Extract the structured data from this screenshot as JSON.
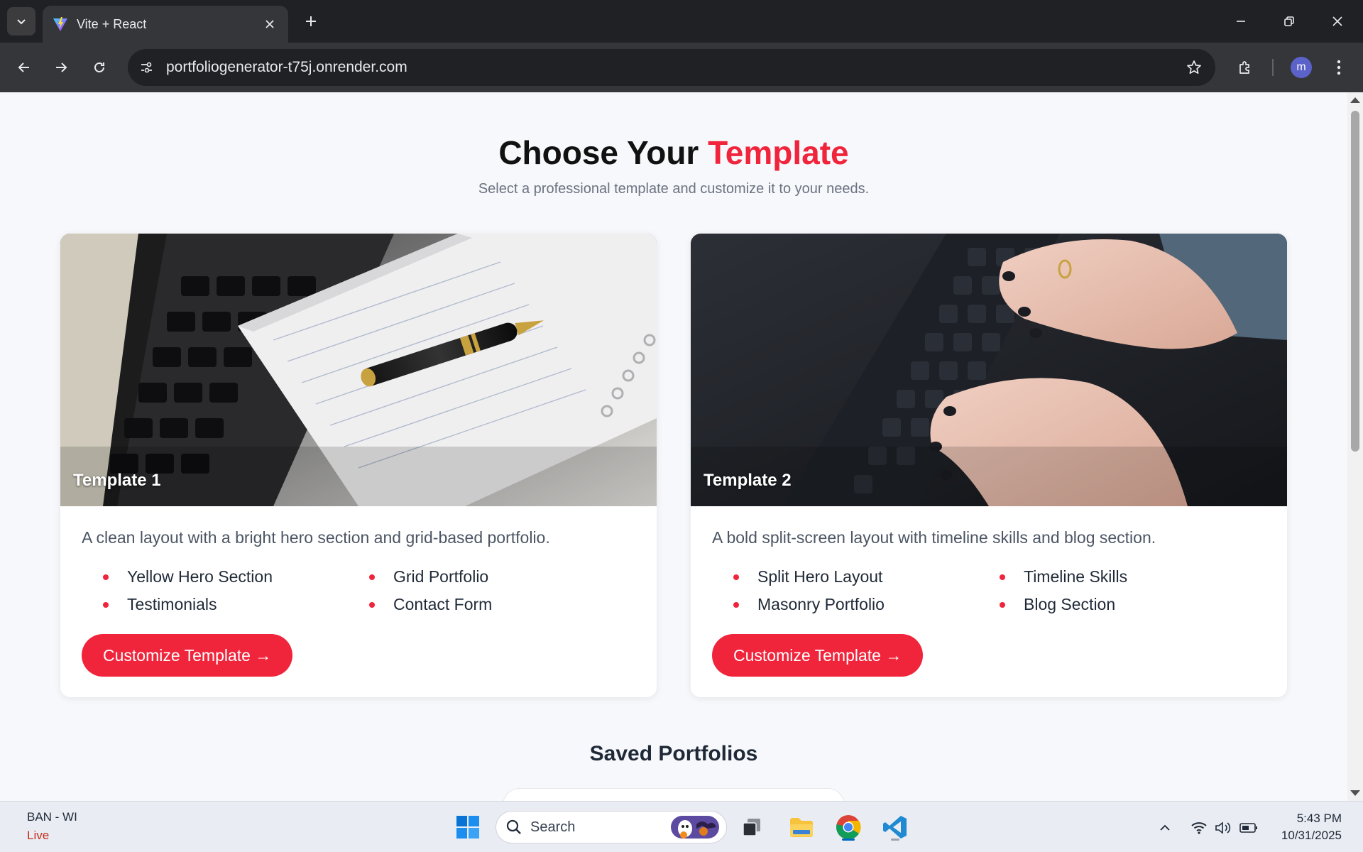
{
  "browser": {
    "tab_title": "Vite + React",
    "url": "portfoliogenerator-t75j.onrender.com",
    "profile_initial": "m"
  },
  "page": {
    "heading_main": "Choose Your",
    "heading_accent": "Template",
    "subtitle": "Select a professional template and customize it to your needs.",
    "accent_color": "#f0243b",
    "templates": [
      {
        "label": "Template 1",
        "description": "A clean layout with a bright hero section and grid-based portfolio.",
        "features": [
          "Yellow Hero Section",
          "Grid Portfolio",
          "Testimonials",
          "Contact Form"
        ],
        "cta": "Customize Template →"
      },
      {
        "label": "Template 2",
        "description": "A bold split-screen layout with timeline skills and blog section.",
        "features": [
          "Split Hero Layout",
          "Timeline Skills",
          "Masonry Portfolio",
          "Blog Section"
        ],
        "cta": "Customize Template →"
      }
    ],
    "saved_title": "Saved Portfolios"
  },
  "taskbar": {
    "weather_location": "BAN - WI",
    "weather_status": "Live",
    "search_placeholder": "Search",
    "time": "5:43 PM",
    "date": "10/31/2025"
  }
}
